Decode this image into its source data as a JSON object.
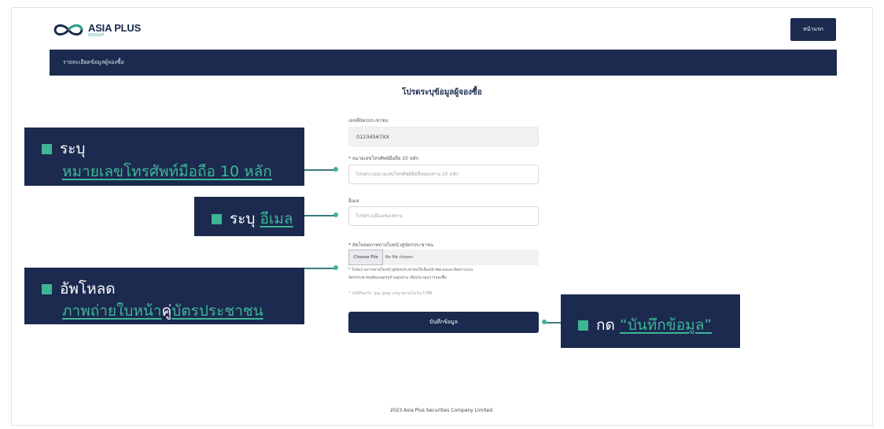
{
  "header": {
    "logo_text": "ASIA PLUS",
    "logo_sub": "GROUP",
    "home_button": "หน้าแรก"
  },
  "nav": {
    "label": "รายละเอียดข้อมูลผู้จองซื้อ"
  },
  "form": {
    "title": "โปรดระบุข้อมูลผู้จองซื้อ",
    "id_label": "เลขที่บัตรประชาชน",
    "id_value": "01234567XX",
    "phone_label": "* หมายเลขโทรศัพท์มือถือ 10 หลัก",
    "phone_placeholder": "โปรดระบุหมายเลขโทรศัพท์มือถือของท่าน 10 หลัก",
    "email_label": "อีเมล",
    "email_placeholder": "โปรดระบุอีเมลของท่าน",
    "upload_label": "* อัพโหลดภาพถ่ายใบหน้าคู่บัตรประชาชน",
    "file_button": "Choose File",
    "file_status": "No file chosen",
    "note_line1": "* โปรดถ่ายภาพถ่ายใบหน้าคู่บัตรประชาชนให้เห็นหน้าชัดเจนและข้อความบน",
    "note_line2": "บัตรประชาชนชัดเจนครบถ้วนทุกส่วน เพื่อประกอบการจองซื้อ",
    "file_types": "* ไฟล์ที่รองรับ: jpg, jpeg, png ขนาดไม่เกิน 5 MB",
    "save_button": "บันทึกข้อมูล"
  },
  "callouts": {
    "phone_prefix": "ระบุ",
    "phone_link": "หมายเลขโทรศัพท์มือถือ 10 หลัก",
    "email_prefix": "ระบุ",
    "email_link": "อีเมล",
    "upload_prefix": "อัพโหลด",
    "upload_link_a": "ภาพถ่ายใบหน้า",
    "upload_link_b": "คู่",
    "upload_link_c": "บัตรประชาชน",
    "save_prefix": "กด",
    "save_quote_open": "“",
    "save_link": "บันทึกข้อมูล",
    "save_quote_close": "”"
  },
  "footer": {
    "copyright": "2023 Asia Plus Securities Company Limited."
  },
  "colors": {
    "navy": "#1b2a4e",
    "accent": "#3fb497"
  }
}
